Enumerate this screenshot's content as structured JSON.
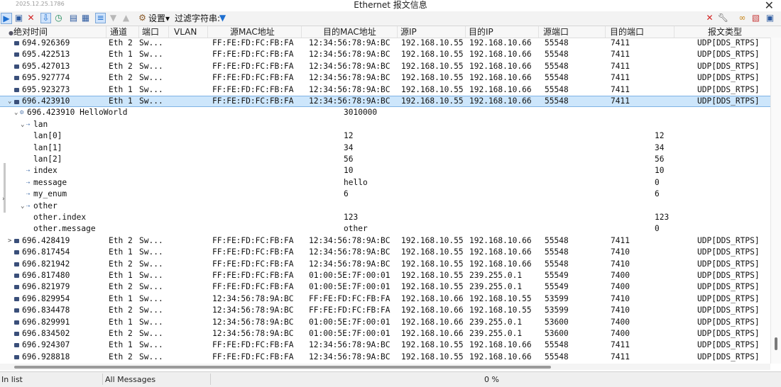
{
  "window": {
    "timestamp": "2025.12.25.1786",
    "title": "Ethernet 报文信息",
    "close": "✕"
  },
  "toolbar": {
    "settings_label": "设置",
    "filter_label": "过滤字符串:"
  },
  "columns": [
    "绝对时间",
    "通道",
    "端口",
    "VLAN",
    "源MAC地址",
    "目的MAC地址",
    "源IP",
    "目的IP",
    "源端口",
    "目的端口",
    "报文类型"
  ],
  "rows": [
    {
      "kind": "msg",
      "exp": "",
      "time": "694.926369",
      "ch": "Eth 2",
      "port": "Sw...",
      "smac": "FF:FE:FD:FC:FB:FA",
      "dmac": "12:34:56:78:9A:BC",
      "sip": "192.168.10.55",
      "dip": "192.168.10.66",
      "sport": "55548",
      "dport": "7411",
      "type": "UDP[DDS_RTPS]"
    },
    {
      "kind": "msg",
      "exp": "",
      "time": "695.422513",
      "ch": "Eth 1",
      "port": "Sw...",
      "smac": "FF:FE:FD:FC:FB:FA",
      "dmac": "12:34:56:78:9A:BC",
      "sip": "192.168.10.55",
      "dip": "192.168.10.66",
      "sport": "55548",
      "dport": "7411",
      "type": "UDP[DDS_RTPS]"
    },
    {
      "kind": "msg",
      "exp": "",
      "time": "695.427013",
      "ch": "Eth 2",
      "port": "Sw...",
      "smac": "FF:FE:FD:FC:FB:FA",
      "dmac": "12:34:56:78:9A:BC",
      "sip": "192.168.10.55",
      "dip": "192.168.10.66",
      "sport": "55548",
      "dport": "7411",
      "type": "UDP[DDS_RTPS]"
    },
    {
      "kind": "msg",
      "exp": "",
      "time": "695.927774",
      "ch": "Eth 2",
      "port": "Sw...",
      "smac": "FF:FE:FD:FC:FB:FA",
      "dmac": "12:34:56:78:9A:BC",
      "sip": "192.168.10.55",
      "dip": "192.168.10.66",
      "sport": "55548",
      "dport": "7411",
      "type": "UDP[DDS_RTPS]"
    },
    {
      "kind": "msg",
      "exp": "",
      "time": "695.923273",
      "ch": "Eth 1",
      "port": "Sw...",
      "smac": "FF:FE:FD:FC:FB:FA",
      "dmac": "12:34:56:78:9A:BC",
      "sip": "192.168.10.55",
      "dip": "192.168.10.66",
      "sport": "55548",
      "dport": "7411",
      "type": "UDP[DDS_RTPS]"
    },
    {
      "kind": "msg",
      "exp": "⌄",
      "sel": true,
      "time": "696.423910",
      "ch": "Eth 1",
      "port": "Sw...",
      "smac": "FF:FE:FD:FC:FB:FA",
      "dmac": "12:34:56:78:9A:BC",
      "sip": "192.168.10.55",
      "dip": "192.168.10.66",
      "sport": "55548",
      "dport": "7411",
      "type": "UDP[DDS_RTPS]"
    },
    {
      "kind": "node",
      "lvl": 1,
      "exp": "⌄",
      "name": "696.423910 HelloWorld",
      "v1": "3010000",
      "v2": ""
    },
    {
      "kind": "node",
      "lvl": 2,
      "exp": "⌄",
      "name": "lan",
      "v1": "",
      "v2": ""
    },
    {
      "kind": "leaf",
      "lvl": 3,
      "name": "lan[0]",
      "v1": "12",
      "v2": "12"
    },
    {
      "kind": "leaf",
      "lvl": 3,
      "name": "lan[1]",
      "v1": "34",
      "v2": "34"
    },
    {
      "kind": "leaf",
      "lvl": 3,
      "name": "lan[2]",
      "v1": "56",
      "v2": "56"
    },
    {
      "kind": "node",
      "lvl": 2,
      "exp": "",
      "name": "index",
      "v1": "10",
      "v2": "10"
    },
    {
      "kind": "node",
      "lvl": 2,
      "exp": "",
      "name": "message",
      "v1": "hello",
      "v2": "0"
    },
    {
      "kind": "node",
      "lvl": 2,
      "exp": "",
      "name": "my_enum",
      "v1": "6",
      "v2": "6"
    },
    {
      "kind": "node",
      "lvl": 2,
      "exp": "⌄",
      "name": "other",
      "v1": "",
      "v2": ""
    },
    {
      "kind": "leaf",
      "lvl": 3,
      "name": "other.index",
      "v1": "123",
      "v2": "123"
    },
    {
      "kind": "leaf",
      "lvl": 3,
      "name": "other.message",
      "v1": "other",
      "v2": "0"
    },
    {
      "kind": "msg",
      "exp": ">",
      "time": "696.428419",
      "ch": "Eth 2",
      "port": "Sw...",
      "smac": "FF:FE:FD:FC:FB:FA",
      "dmac": "12:34:56:78:9A:BC",
      "sip": "192.168.10.55",
      "dip": "192.168.10.66",
      "sport": "55548",
      "dport": "7411",
      "type": "UDP[DDS_RTPS]"
    },
    {
      "kind": "msg",
      "exp": "",
      "time": "696.817454",
      "ch": "Eth 1",
      "port": "Sw...",
      "smac": "FF:FE:FD:FC:FB:FA",
      "dmac": "12:34:56:78:9A:BC",
      "sip": "192.168.10.55",
      "dip": "192.168.10.66",
      "sport": "55548",
      "dport": "7410",
      "type": "UDP[DDS_RTPS]"
    },
    {
      "kind": "msg",
      "exp": "",
      "time": "696.821942",
      "ch": "Eth 2",
      "port": "Sw...",
      "smac": "FF:FE:FD:FC:FB:FA",
      "dmac": "12:34:56:78:9A:BC",
      "sip": "192.168.10.55",
      "dip": "192.168.10.66",
      "sport": "55548",
      "dport": "7410",
      "type": "UDP[DDS_RTPS]"
    },
    {
      "kind": "msg",
      "exp": "",
      "time": "696.817480",
      "ch": "Eth 1",
      "port": "Sw...",
      "smac": "FF:FE:FD:FC:FB:FA",
      "dmac": "01:00:5E:7F:00:01",
      "sip": "192.168.10.55",
      "dip": "239.255.0.1",
      "sport": "55549",
      "dport": "7400",
      "type": "UDP[DDS_RTPS]"
    },
    {
      "kind": "msg",
      "exp": "",
      "time": "696.821979",
      "ch": "Eth 2",
      "port": "Sw...",
      "smac": "FF:FE:FD:FC:FB:FA",
      "dmac": "01:00:5E:7F:00:01",
      "sip": "192.168.10.55",
      "dip": "239.255.0.1",
      "sport": "55549",
      "dport": "7400",
      "type": "UDP[DDS_RTPS]"
    },
    {
      "kind": "msg",
      "exp": "",
      "time": "696.829954",
      "ch": "Eth 1",
      "port": "Sw...",
      "smac": "12:34:56:78:9A:BC",
      "dmac": "FF:FE:FD:FC:FB:FA",
      "sip": "192.168.10.66",
      "dip": "192.168.10.55",
      "sport": "53599",
      "dport": "7410",
      "type": "UDP[DDS_RTPS]"
    },
    {
      "kind": "msg",
      "exp": "",
      "time": "696.834478",
      "ch": "Eth 2",
      "port": "Sw...",
      "smac": "12:34:56:78:9A:BC",
      "dmac": "FF:FE:FD:FC:FB:FA",
      "sip": "192.168.10.66",
      "dip": "192.168.10.55",
      "sport": "53599",
      "dport": "7410",
      "type": "UDP[DDS_RTPS]"
    },
    {
      "kind": "msg",
      "exp": "",
      "time": "696.829991",
      "ch": "Eth 1",
      "port": "Sw...",
      "smac": "12:34:56:78:9A:BC",
      "dmac": "01:00:5E:7F:00:01",
      "sip": "192.168.10.66",
      "dip": "239.255.0.1",
      "sport": "53600",
      "dport": "7400",
      "type": "UDP[DDS_RTPS]"
    },
    {
      "kind": "msg",
      "exp": "",
      "time": "696.834502",
      "ch": "Eth 2",
      "port": "Sw...",
      "smac": "12:34:56:78:9A:BC",
      "dmac": "01:00:5E:7F:00:01",
      "sip": "192.168.10.66",
      "dip": "239.255.0.1",
      "sport": "53600",
      "dport": "7400",
      "type": "UDP[DDS_RTPS]"
    },
    {
      "kind": "msg",
      "exp": "",
      "time": "696.924307",
      "ch": "Eth 1",
      "port": "Sw...",
      "smac": "FF:FE:FD:FC:FB:FA",
      "dmac": "12:34:56:78:9A:BC",
      "sip": "192.168.10.55",
      "dip": "192.168.10.66",
      "sport": "55548",
      "dport": "7411",
      "type": "UDP[DDS_RTPS]"
    },
    {
      "kind": "msg",
      "exp": "",
      "time": "696.928818",
      "ch": "Eth 2",
      "port": "Sw...",
      "smac": "FF:FE:FD:FC:FB:FA",
      "dmac": "12:34:56:78:9A:BC",
      "sip": "192.168.10.55",
      "dip": "192.168.10.66",
      "sport": "55548",
      "dport": "7411",
      "type": "UDP[DDS_RTPS]"
    }
  ],
  "status": {
    "mode": "In list",
    "filter": "All Messages",
    "progress": "0 %",
    "progress_value": 0
  },
  "colors": {
    "selected_row": "#cde6fb",
    "play_button": "#1e6fd0",
    "delete_red": "#d21f1f"
  }
}
